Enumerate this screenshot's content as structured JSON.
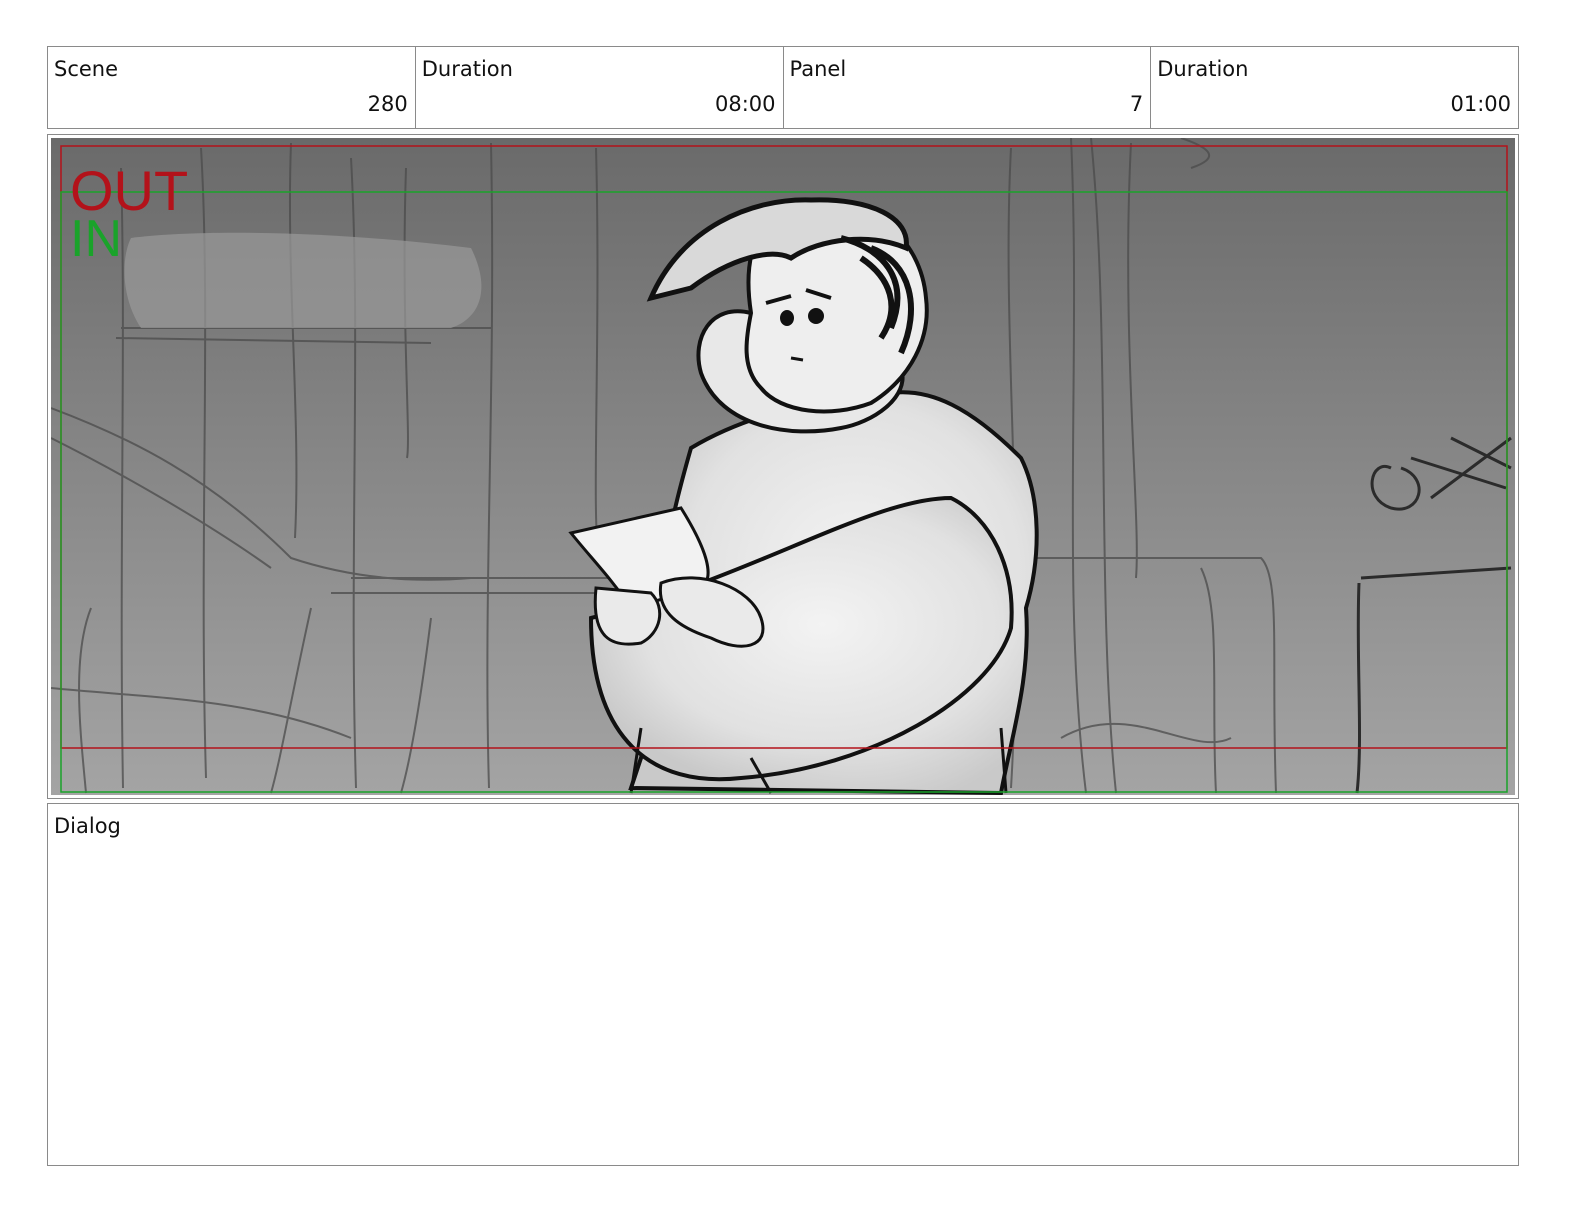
{
  "header": {
    "scene_label": "Scene",
    "scene_value": "280",
    "scene_duration_label": "Duration",
    "scene_duration_value": "08:00",
    "panel_label": "Panel",
    "panel_value": "7",
    "panel_duration_label": "Duration",
    "panel_duration_value": "01:00"
  },
  "frame": {
    "out_label": "OUT",
    "in_label": "IN",
    "out_color": "#b3121a",
    "in_color": "#1aa32a"
  },
  "dialog": {
    "label": "Dialog"
  }
}
